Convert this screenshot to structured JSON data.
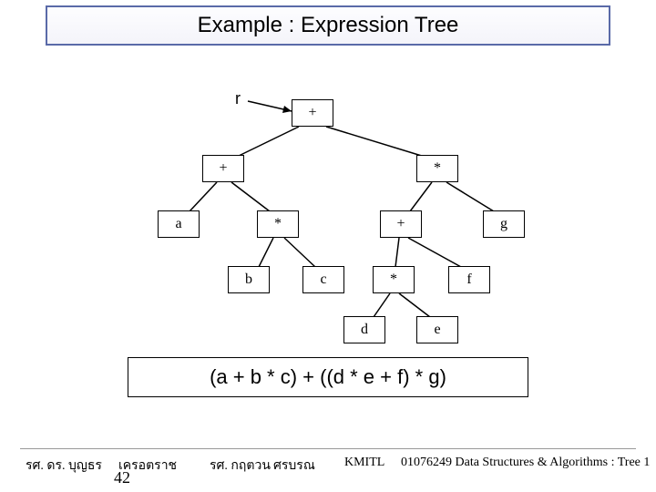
{
  "title": "Example : Expression Tree",
  "tree": {
    "root_pointer_label": "r",
    "nodes": {
      "root": "+",
      "l": "+",
      "r": "*",
      "ll": "a",
      "lr": "*",
      "rl": "+",
      "rr": "g",
      "lrl": "b",
      "lrr": "c",
      "rll": "*",
      "rlr": "f",
      "rlll": "d",
      "rllr": "e"
    }
  },
  "expression": "(a + b * c) + ((d * e + f) * g)",
  "footer": {
    "left1": "รศ. ดร. บุญธร",
    "left2": "เครอตราช",
    "center1": "รศ. กฤตวน",
    "center2": "ศรบรณ",
    "inst": "KMITL",
    "course": "01076249 Data Structures & Algorithms : Tree 1",
    "slide": "42"
  }
}
